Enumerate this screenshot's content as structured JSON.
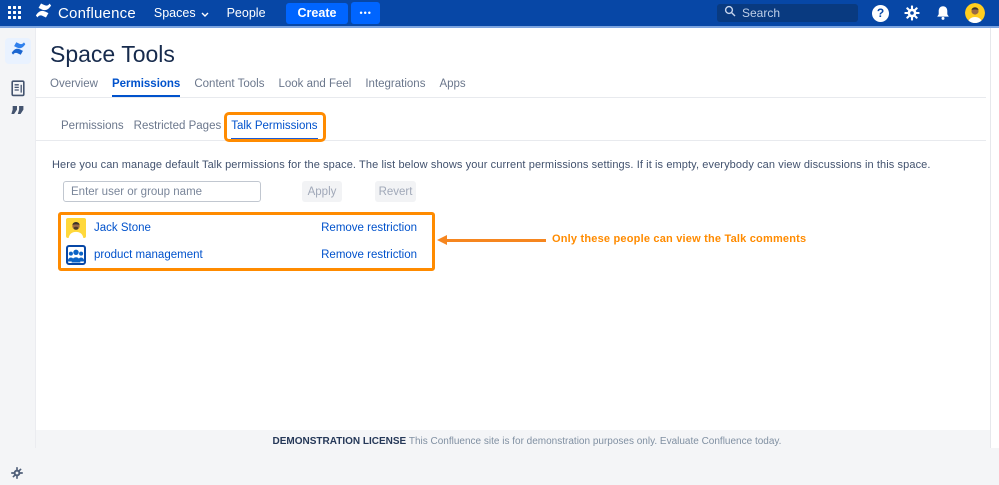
{
  "colors": {
    "navbar_bg": "#0747A6",
    "primary_button_blue": "#0065FF",
    "link_blue": "#0052CC",
    "annotation_orange": "#FF8B00"
  },
  "navbar": {
    "logo_text": "Confluence",
    "spaces_label": "Spaces",
    "people_label": "People",
    "create_label": "Create",
    "more_label": "•••",
    "search_placeholder": "Search",
    "icons": [
      "app-switcher-grid-icon",
      "confluence-logo-icon",
      "chevron-down-icon",
      "search-icon",
      "help-icon",
      "gear-icon",
      "bell-icon",
      "user-avatar"
    ]
  },
  "sidebar": {
    "icons": [
      "confluence-icon",
      "pages-icon",
      "quote-icon"
    ]
  },
  "page": {
    "title": "Space Tools"
  },
  "main_tabs": [
    {
      "label": "Overview",
      "active": false
    },
    {
      "label": "Permissions",
      "active": true
    },
    {
      "label": "Content Tools",
      "active": false
    },
    {
      "label": "Look and Feel",
      "active": false
    },
    {
      "label": "Integrations",
      "active": false
    },
    {
      "label": "Apps",
      "active": false
    }
  ],
  "sub_tabs": [
    {
      "label": "Permissions",
      "active": false
    },
    {
      "label": "Restricted Pages",
      "active": false
    },
    {
      "label": "Talk Permissions",
      "active": true,
      "highlighted": true
    }
  ],
  "description": "Here you can manage default Talk permissions for the space. The list below shows your current permissions settings. If it is empty, everybody can view discussions in this space.",
  "form": {
    "input_placeholder": "Enter user or group name",
    "apply_label": "Apply",
    "revert_label": "Revert"
  },
  "restrictions": [
    {
      "name": "Jack Stone",
      "entity": "user",
      "avatar": "person-photo-yellow",
      "action_label": "Remove restriction"
    },
    {
      "name": "product management",
      "entity": "group",
      "avatar": "people-group-icon",
      "action_label": "Remove restriction"
    }
  ],
  "annotation": {
    "text": "Only these people can view the Talk comments"
  },
  "footer": {
    "license_label": "DEMONSTRATION LICENSE",
    "license_text": "This Confluence site is for demonstration purposes only. Evaluate Confluence today."
  }
}
